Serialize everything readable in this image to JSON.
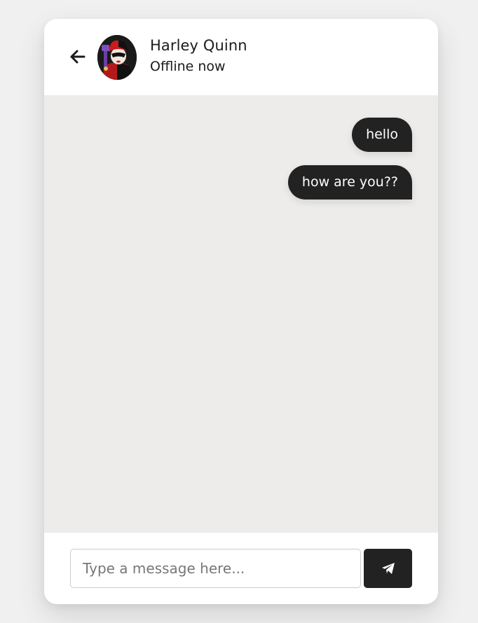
{
  "header": {
    "back_icon": "arrow-left-icon",
    "user_name": "Harley Quinn",
    "status": "Offline now"
  },
  "messages": [
    {
      "direction": "outgoing",
      "text": "hello"
    },
    {
      "direction": "outgoing",
      "text": "how are you??"
    }
  ],
  "typing_area": {
    "placeholder": "Type a message here...",
    "send_icon": "paper-plane-icon"
  },
  "colors": {
    "page_background": "#f0f0f0",
    "card_background": "#ffffff",
    "chat_background": "#edecea",
    "bubble": "#222222",
    "send_button": "#222222",
    "text": "#1b1b1b"
  }
}
